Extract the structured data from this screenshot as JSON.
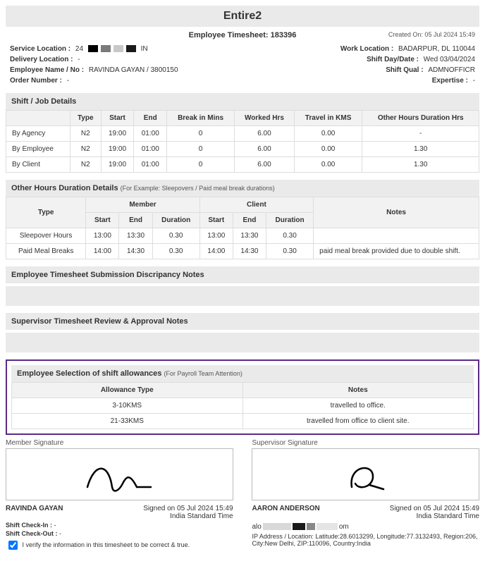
{
  "header": {
    "title": "Entire2",
    "subtitle": "Employee Timesheet: 183396",
    "created_on": "Created On: 05 Jul 2024 15:49"
  },
  "info_left": {
    "service_location_label": "Service Location :",
    "service_location_val_prefix": "24",
    "service_location_val_suffix": "IN",
    "delivery_location_label": "Delivery Location :",
    "delivery_location_val": "-",
    "employee_label": "Employee Name / No :",
    "employee_val": "RAVINDA GAYAN  / 3800150",
    "order_label": "Order Number :",
    "order_val": "-"
  },
  "info_right": {
    "work_location_label": "Work Location :",
    "work_location_val": "BADARPUR, DL 110044",
    "shift_day_label": "Shift Day/Date :",
    "shift_day_val": "Wed 03/04/2024",
    "shift_qual_label": "Shift Qual :",
    "shift_qual_val": "ADMNOFFICR",
    "expertise_label": "Expertise :",
    "expertise_val": "-"
  },
  "shift": {
    "head": "Shift / Job Details",
    "cols": [
      "",
      "Type",
      "Start",
      "End",
      "Break in Mins",
      "Worked Hrs",
      "Travel in KMS",
      "Other Hours Duration Hrs"
    ],
    "rows": [
      {
        "label": "By Agency",
        "type": "N2",
        "start": "19:00",
        "end": "01:00",
        "break": "0",
        "worked": "6.00",
        "travel": "0.00",
        "other": "-"
      },
      {
        "label": "By Employee",
        "type": "N2",
        "start": "19:00",
        "end": "01:00",
        "break": "0",
        "worked": "6.00",
        "travel": "0.00",
        "other": "1.30"
      },
      {
        "label": "By Client",
        "type": "N2",
        "start": "19:00",
        "end": "01:00",
        "break": "0",
        "worked": "6.00",
        "travel": "0.00",
        "other": "1.30"
      }
    ]
  },
  "other_hours": {
    "head": "Other Hours Duration Details",
    "sub": "(For Example: Sleepovers / Paid meal break durations)",
    "top_cols": {
      "type": "Type",
      "member": "Member",
      "client": "Client",
      "notes": "Notes"
    },
    "sub_cols": {
      "start": "Start",
      "end": "End",
      "duration": "Duration"
    },
    "rows": [
      {
        "label": "Sleepover Hours",
        "m_start": "13:00",
        "m_end": "13:30",
        "m_dur": "0.30",
        "c_start": "13:00",
        "c_end": "13:30",
        "c_dur": "0.30",
        "notes": ""
      },
      {
        "label": "Paid Meal Breaks",
        "m_start": "14:00",
        "m_end": "14:30",
        "m_dur": "0.30",
        "c_start": "14:00",
        "c_end": "14:30",
        "c_dur": "0.30",
        "notes": "paid meal break provided due to double shift."
      }
    ]
  },
  "discrepancy_head": "Employee Timesheet Submission Discripancy Notes",
  "supervisor_head": "Supervisor Timesheet Review & Approval Notes",
  "allowances": {
    "head": "Employee Selection of shift allowances",
    "sub": "(For Payroll Team Attention)",
    "cols": {
      "type": "Allowance Type",
      "notes": "Notes"
    },
    "rows": [
      {
        "type": "3-10KMS",
        "notes": "travelled to office."
      },
      {
        "type": "21-33KMS",
        "notes": "travelled from office to client site."
      }
    ]
  },
  "sig": {
    "member_label": "Member Signature",
    "supervisor_label": "Supervisor Signature",
    "member_name": "RAVINDA GAYAN",
    "supervisor_name": "AARON ANDERSON",
    "signed_line1": "Signed on 05 Jul 2024 15:49",
    "signed_line2": "India Standard Time",
    "checkin_label": "Shift Check-In :",
    "checkin_val": "-",
    "checkout_label": "Shift Check-Out :",
    "checkout_val": "-",
    "verify": "I verify the information in this timesheet to be correct & true.",
    "email_prefix": "alo",
    "email_suffix": "om",
    "ip_line": "IP Address / Location: Latitude:28.6013299, Longitude:77.3132493, Region:206, City:New Delhi, ZIP:110096, Country:India"
  }
}
